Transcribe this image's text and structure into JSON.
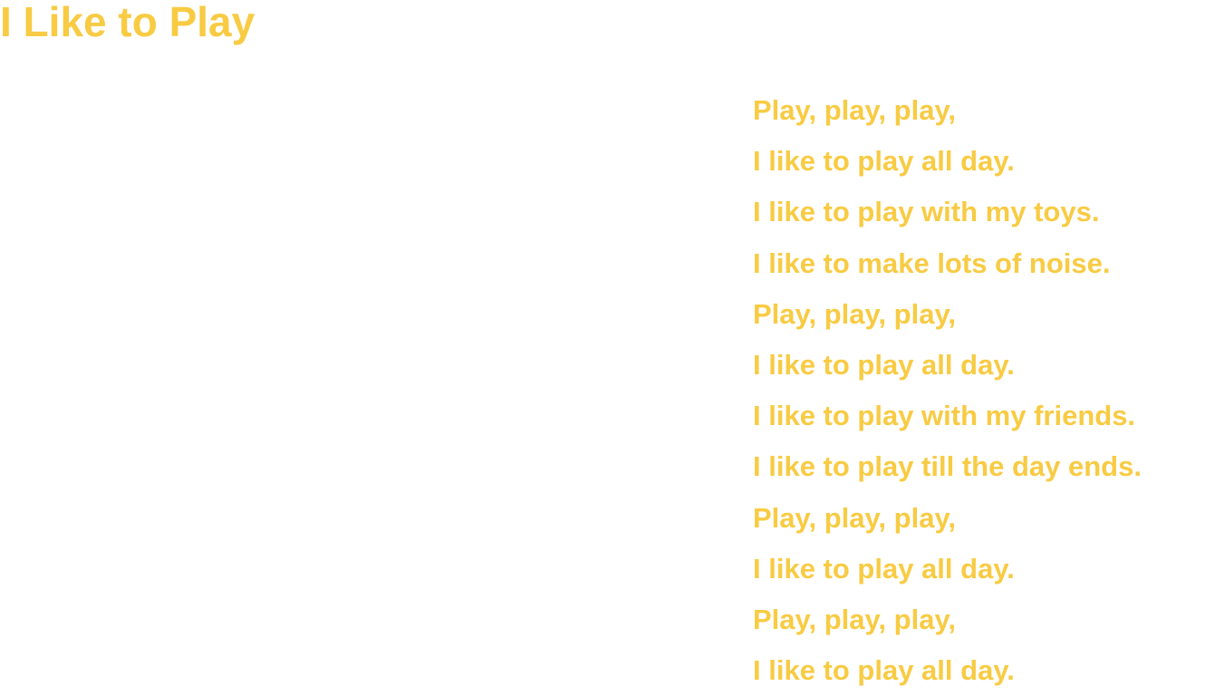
{
  "title": "I Like to Play",
  "accent_color": "#F8CB43",
  "lines": [
    "Play, play, play,",
    "I like to play all day.",
    "I like to play with my toys.",
    "I like to make lots of noise.",
    "Play, play, play,",
    "I like to play all day.",
    "I like to play with my friends.",
    "I like to play till the day ends.",
    "Play, play, play,",
    "I like to play all day.",
    "Play, play, play,",
    "I like to play all day."
  ]
}
